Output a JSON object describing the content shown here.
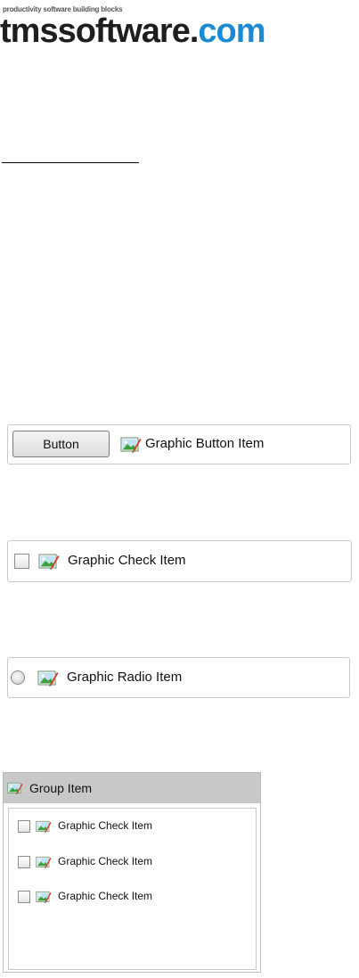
{
  "logo": {
    "tagline": "productivity software building blocks",
    "name": "tmssoftware",
    "dot": ".",
    "tld": "com"
  },
  "button_item": {
    "button_label": "Button",
    "item_label": "Graphic Button Item"
  },
  "check_item": {
    "label": "Graphic Check Item",
    "checked": false
  },
  "radio_item": {
    "label": "Graphic Radio Item",
    "selected": false
  },
  "group_item": {
    "title": "Group Item",
    "items": [
      {
        "label": "Graphic Check Item",
        "checked": false
      },
      {
        "label": "Graphic Check Item",
        "checked": false
      },
      {
        "label": "Graphic Check Item",
        "checked": false
      }
    ]
  },
  "icons": {
    "graphic": "picture-icon"
  },
  "colors": {
    "brand_blue": "#1a8bd2",
    "brand_dark": "#1e1e1e",
    "group_header": "#c8c8c8",
    "panel_border": "#c9c9c9"
  }
}
